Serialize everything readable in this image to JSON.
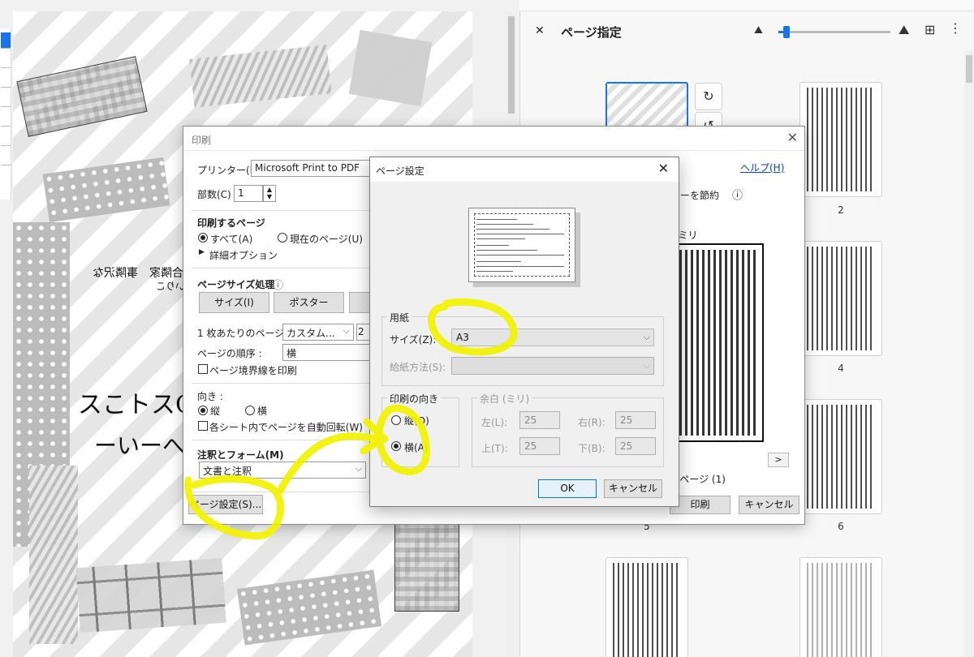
{
  "right_panel": {
    "title": "ページ指定",
    "thumbnails": [
      {
        "label": "2"
      },
      {
        "label": "4"
      },
      {
        "label": "5"
      },
      {
        "label": "6"
      }
    ]
  },
  "document": {
    "mirrored_lines": [
      "ふ合隣家　事隣沢な",
      "いりこ"
    ],
    "handwritten_lines": [
      "スこトスC",
      "ーいーへ"
    ]
  },
  "print_dialog": {
    "title": "印刷",
    "printer_label": "プリンター(N) :",
    "printer_value": "Microsoft Print to PDF",
    "copies_label": "部数(C) :",
    "copies_value": "1",
    "help_link": "ヘルプ(H)",
    "toner_save": "ナーを節約",
    "pages_heading": "印刷するページ",
    "pages_all": "すべて(A)",
    "pages_current": "現在のページ(U)",
    "detail_options": "詳細オプション",
    "page_size_heading": "ページサイズ処理",
    "size_button": "サイズ(I)",
    "poster_button": "ポスター",
    "pages_per_sheet_label": "1 枚あたりのページ数 :",
    "pages_per_sheet_value": "カスタム...",
    "pages_per_sheet_count": "2",
    "page_order_label": "ページの順序 :",
    "page_order_value": "横",
    "print_border": "ページ境界線を印刷",
    "orientation_label": "向き :",
    "orientation_portrait": "縦",
    "orientation_landscape": "横",
    "auto_rotate": "各シート内でページを自動回転(W)",
    "annotations_heading": "注釈とフォーム(M)",
    "annotations_value": "文書と注釈",
    "page_setup_button": "ページ設定(S)...",
    "preview_scale": "1 ミリ",
    "page_count": "/ 2 ページ (1)",
    "next_page": ">",
    "print_button": "印刷",
    "cancel_button": "キャンセル"
  },
  "page_setup": {
    "title": "ページ設定",
    "paper_legend": "用紙",
    "size_label": "サイズ(Z):",
    "size_value": "A3",
    "source_label": "給紙方法(S):",
    "source_value": "",
    "orientation_legend": "印刷の向き",
    "portrait": "縦(O)",
    "landscape": "横(A)",
    "margins_legend": "余白 (ミリ)",
    "margin_left_label": "左(L):",
    "margin_left": "25",
    "margin_right_label": "右(R):",
    "margin_right": "25",
    "margin_top_label": "上(T):",
    "margin_top": "25",
    "margin_bottom_label": "下(B):",
    "margin_bottom": "25",
    "ok_button": "OK",
    "cancel_button": "キャンセル"
  },
  "icons": [
    "close-icon",
    "zoom-out-mountain-icon",
    "zoom-in-mountain-icon",
    "insert-page-icon",
    "more-icon",
    "rotate-cw-icon",
    "rotate-ccw-icon",
    "info-icon",
    "dropdown-arrow-icon"
  ],
  "colors": {
    "highlight": "#f2f200",
    "accent": "#1a73e8",
    "link": "#0645ad"
  },
  "zoom_level": 0.07,
  "states": {
    "pages_all": true,
    "orientation_portrait": true,
    "setup_landscape": true,
    "print_border": false,
    "auto_rotate": false
  }
}
